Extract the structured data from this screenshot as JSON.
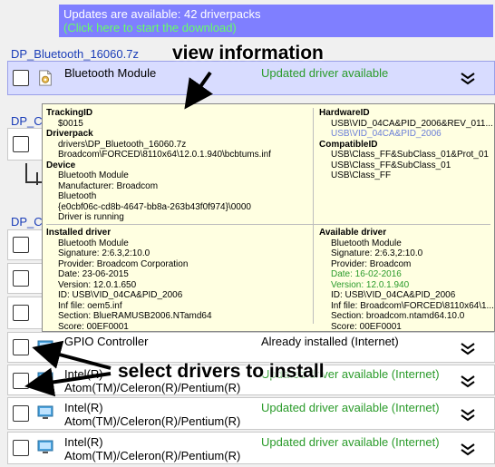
{
  "banner": {
    "title": "Updates are available: 42 driverpacks",
    "subtitle": "(Click here to start the download)"
  },
  "packs": [
    {
      "title": "DP_Bluetooth_16060.7z"
    },
    {
      "title": "DP_C"
    },
    {
      "title": "DP_C"
    }
  ],
  "rows": [
    {
      "name": "Bluetooth Module",
      "status": "Updated driver available",
      "status_color": "green"
    },
    {
      "name": "GPIO Controller",
      "status": "Already installed (Internet)",
      "status_color": "black"
    },
    {
      "name": "Intel(R)",
      "name2": "Atom(TM)/Celeron(R)/Pentium(R)",
      "status": "Updated driver available (Internet)",
      "status_color": "green"
    },
    {
      "name": "Intel(R)",
      "name2": "Atom(TM)/Celeron(R)/Pentium(R)",
      "status": "Updated driver available (Internet)",
      "status_color": "green"
    },
    {
      "name": "Intel(R)",
      "name2": "Atom(TM)/Celeron(R)/Pentium(R)",
      "status": "Updated driver available (Internet)",
      "status_color": "green"
    }
  ],
  "tooltip": {
    "tracking_label": "TrackingID",
    "tracking_value": "$0015",
    "driverpack_label": "Driverpack",
    "driverpack_lines": [
      "drivers\\DP_Bluetooth_16060.7z",
      "Broadcom\\FORCED\\8110x64\\12.0.1.940\\bcbtums.inf"
    ],
    "device_label": "Device",
    "device_lines": [
      "Bluetooth Module",
      "Manufacturer: Broadcom",
      "Bluetooth",
      "{e0cbf06c-cd8b-4647-bb8a-263b43f0f974}\\0000",
      "Driver is running"
    ],
    "hardware_label": "HardwareID",
    "hardware_lines": [
      "USB\\VID_04CA&PID_2006&REV_011...",
      "USB\\VID_04CA&PID_2006"
    ],
    "compatible_label": "CompatibleID",
    "compatible_lines": [
      "USB\\Class_FF&SubClass_01&Prot_01",
      "USB\\Class_FF&SubClass_01",
      "USB\\Class_FF"
    ],
    "installed_label": "Installed driver",
    "installed_lines": [
      "Bluetooth Module",
      "Signature: 2:6.3,2:10.0",
      "Provider: Broadcom Corporation",
      "Date: 23-06-2015",
      "Version: 12.0.1.650",
      "ID: USB\\VID_04CA&PID_2006",
      "Inf file: oem5.inf",
      "Section: BlueRAMUSB2006.NTamd64",
      "Score: 00EF0001"
    ],
    "available_label": "Available driver",
    "available_lines": [
      "Bluetooth Module",
      "Signature: 2:6.3,2:10.0",
      "Provider: Broadcom",
      "Date: 16-02-2016",
      "Version: 12.0.1.940",
      "ID: USB\\VID_04CA&PID_2006",
      "Inf file: Broadcom\\FORCED\\8110x64\\1...",
      "Section: broadcom.ntamd64.10.0",
      "Score: 00EF0001"
    ]
  },
  "callouts": {
    "view_info": "view information",
    "select_drivers": "select drivers to install"
  },
  "colors": {
    "banner_bg": "#7f7fff",
    "green": "#2a9b2a",
    "pack_title": "#1a3db8",
    "tooltip_bg": "#ffffe1"
  }
}
